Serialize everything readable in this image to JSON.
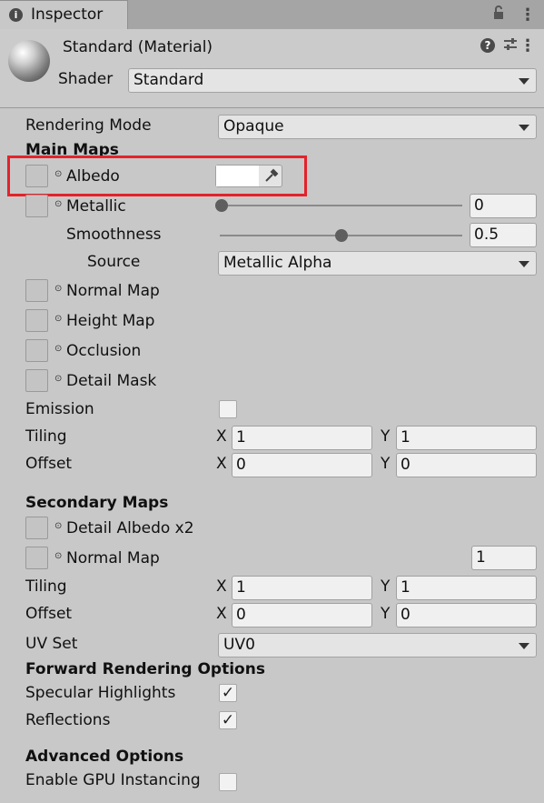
{
  "tab": {
    "title": "Inspector"
  },
  "header": {
    "material_title": "Standard (Material)",
    "shader_label": "Shader",
    "shader_value": "Standard"
  },
  "rendering_mode": {
    "label": "Rendering Mode",
    "value": "Opaque"
  },
  "main_maps": {
    "heading": "Main Maps",
    "albedo": "Albedo",
    "metallic": {
      "label": "Metallic",
      "value": "0",
      "slider_fraction": 0
    },
    "smoothness": {
      "label": "Smoothness",
      "value": "0.5",
      "slider_fraction": 0.5
    },
    "source": {
      "label": "Source",
      "value": "Metallic Alpha"
    },
    "normal_map": "Normal Map",
    "height_map": "Height Map",
    "occlusion": "Occlusion",
    "detail_mask": "Detail Mask",
    "emission": "Emission",
    "tiling": {
      "label": "Tiling",
      "x_label": "X",
      "x": "1",
      "y_label": "Y",
      "y": "1"
    },
    "offset": {
      "label": "Offset",
      "x_label": "X",
      "x": "0",
      "y_label": "Y",
      "y": "0"
    }
  },
  "secondary_maps": {
    "heading": "Secondary Maps",
    "detail_albedo": "Detail Albedo x2",
    "normal_map": {
      "label": "Normal Map",
      "value": "1"
    },
    "tiling": {
      "label": "Tiling",
      "x_label": "X",
      "x": "1",
      "y_label": "Y",
      "y": "1"
    },
    "offset": {
      "label": "Offset",
      "x_label": "X",
      "x": "0",
      "y_label": "Y",
      "y": "0"
    },
    "uv_set": {
      "label": "UV Set",
      "value": "UV0"
    }
  },
  "forward_rendering": {
    "heading": "Forward Rendering Options",
    "specular_highlights": {
      "label": "Specular Highlights",
      "checked": true
    },
    "reflections": {
      "label": "Reflections",
      "checked": true
    }
  },
  "advanced": {
    "heading": "Advanced Options",
    "gpu_instancing": {
      "label": "Enable GPU Instancing",
      "checked": false
    }
  },
  "icons": {
    "info": "i",
    "lock": "lock-icon",
    "kebab": "⋮",
    "help": "?",
    "settings": "⚟",
    "picker_glyph": "⊙",
    "eyedropper": "eyedropper-icon",
    "checkmark": "✓"
  }
}
